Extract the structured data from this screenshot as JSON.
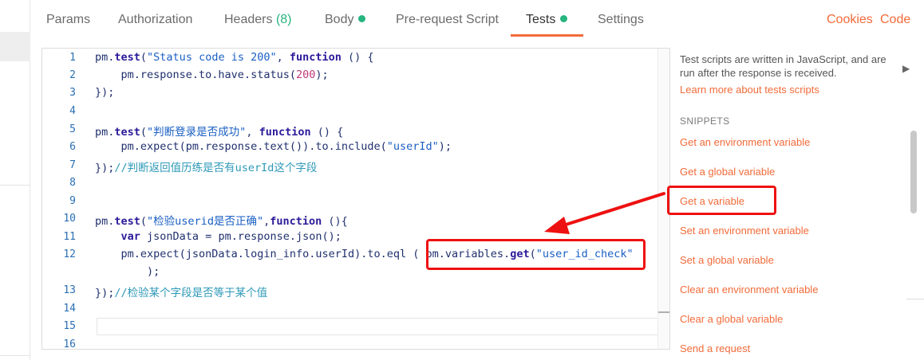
{
  "tabs": {
    "params": "Params",
    "authorization": "Authorization",
    "headers": "Headers",
    "headers_count": "(8)",
    "body": "Body",
    "prerequest": "Pre-request Script",
    "tests": "Tests",
    "settings": "Settings",
    "cookies": "Cookies",
    "code": "Code"
  },
  "editor": {
    "line_numbers": [
      "1",
      "2",
      "3",
      "4",
      "5",
      "6",
      "7",
      "8",
      "9",
      "10",
      "11",
      "12",
      "13",
      "14",
      "15",
      "16"
    ],
    "l1_obj": "pm.",
    "l1_fn": "test",
    "l1_open": "(",
    "l1_str": "\"Status code is 200\"",
    "l1_comma": ", ",
    "l1_kw": "function",
    "l1_rest": " () {",
    "l2_code": "    pm.response.to.have.status(",
    "l2_num": "200",
    "l2_close": ");",
    "l3": "});",
    "l5_obj": "pm.",
    "l5_fn": "test",
    "l5_open": "(",
    "l5_str": "\"判断登录是否成功\"",
    "l5_comma": ", ",
    "l5_kw": "function",
    "l5_rest": " () {",
    "l6_code": "    pm.expect(pm.response.text()).to.include(",
    "l6_str": "\"userId\"",
    "l6_close": ");",
    "l7_code": "});",
    "l7_comment": "//判断返回值历练是否有userId这个字段",
    "l10_obj": "pm.",
    "l10_fn": "test",
    "l10_open": "(",
    "l10_str": "\"检验userid是否正确\"",
    "l10_comma": ",",
    "l10_kw": "function",
    "l10_rest": " (){",
    "l11_kw": "    var",
    "l11_rest": " jsonData = pm.response.json();",
    "l12_code": "    pm.expect(jsonData.login_info.userId).to.eql ( ",
    "l12_obj": "pm.variables.",
    "l12_fn": "get",
    "l12_open": "(",
    "l12_str": "\"user_id_check\"",
    "l12_wrap": "        );",
    "l13_code": "});",
    "l13_comment": "//检验某个字段是否等于某个值"
  },
  "panel": {
    "description": "Test scripts are written in JavaScript, and are run after the response is received.",
    "learn_link": "Learn more about tests scripts",
    "expand_icon": "▶",
    "snippets_heading": "SNIPPETS",
    "snippets": [
      "Get an environment variable",
      "Get a global variable",
      "Get a variable",
      "Set an environment variable",
      "Set a global variable",
      "Clear an environment variable",
      "Clear a global variable",
      "Send a request"
    ]
  },
  "colors": {
    "accent": "#f26b3a",
    "status_green": "#26b47f",
    "annotation_red": "#ee1111"
  }
}
